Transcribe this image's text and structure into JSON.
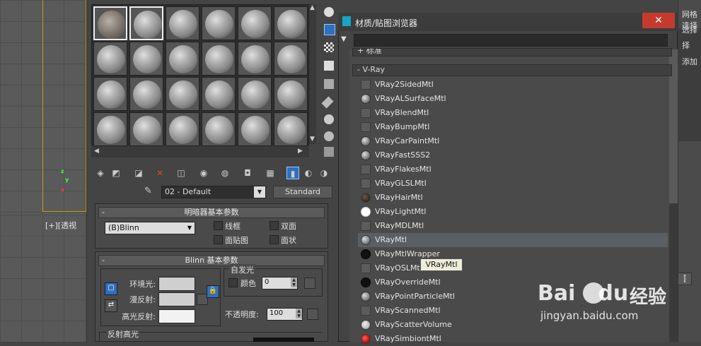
{
  "viewport": {
    "label": "[+][透视",
    "axis_z": "z",
    "axis_y": "y",
    "axis_x": "x"
  },
  "material_editor": {
    "material_name": "02 - Default",
    "material_type": "Standard",
    "shader_rollout": {
      "title": "明暗器基本参数",
      "shader": "(B)Blinn",
      "wire": "线框",
      "two_sided": "双面",
      "face_map": "面贴图",
      "faceted": "面状"
    },
    "blinn_rollout": {
      "title": "Blinn 基本参数",
      "self_illum": "自发光",
      "color": "颜色",
      "color_value": "0",
      "ambient": "环境光:",
      "diffuse": "漫反射:",
      "specular": "高光反射:",
      "opacity": "不透明度:",
      "opacity_value": "100",
      "spec_highlights": "反射高光"
    }
  },
  "browser": {
    "title": "材质/贴图浏览器",
    "close_label": "✕",
    "group_standard": "+ 标准",
    "group_vray": "- V-Ray",
    "items": [
      {
        "label": "VRay2SidedMtl",
        "icon": "blank"
      },
      {
        "label": "VRayALSurfaceMtl",
        "icon": "ball"
      },
      {
        "label": "VRayBlendMtl",
        "icon": "blank"
      },
      {
        "label": "VRayBumpMtl",
        "icon": "blank"
      },
      {
        "label": "VRayCarPaintMtl",
        "icon": "ball"
      },
      {
        "label": "VRayFastSSS2",
        "icon": "ball"
      },
      {
        "label": "VRayFlakesMtl",
        "icon": "blank"
      },
      {
        "label": "VRayGLSLMtl",
        "icon": "blank"
      },
      {
        "label": "VRayHairMtl",
        "icon": "hair"
      },
      {
        "label": "VRayLightMtl",
        "icon": "white"
      },
      {
        "label": "VRayMDLMtl",
        "icon": "blank"
      },
      {
        "label": "VRayMtl",
        "icon": "ball"
      },
      {
        "label": "VRayMtlWrapper",
        "icon": "black"
      },
      {
        "label": "VRayOSLMtl",
        "icon": "blank"
      },
      {
        "label": "VRayOverrideMtl",
        "icon": "black"
      },
      {
        "label": "VRayPointParticleMtl",
        "icon": "ball"
      },
      {
        "label": "VRayScannedMtl",
        "icon": "blank"
      },
      {
        "label": "VRayScatterVolume",
        "icon": "scatter"
      },
      {
        "label": "VRaySimbiontMtl",
        "icon": "red"
      }
    ],
    "highlighted_index": 11,
    "tooltip": "VRayMtl"
  },
  "right_panel": {
    "line1": "网格选择",
    "line2": "选择",
    "line3": "择",
    "line4": "添加",
    "button": "⫿"
  },
  "watermark": {
    "logo": "Bai",
    "logo_tail": "du",
    "cn": "经验",
    "url": "jingyan.baidu.com"
  }
}
